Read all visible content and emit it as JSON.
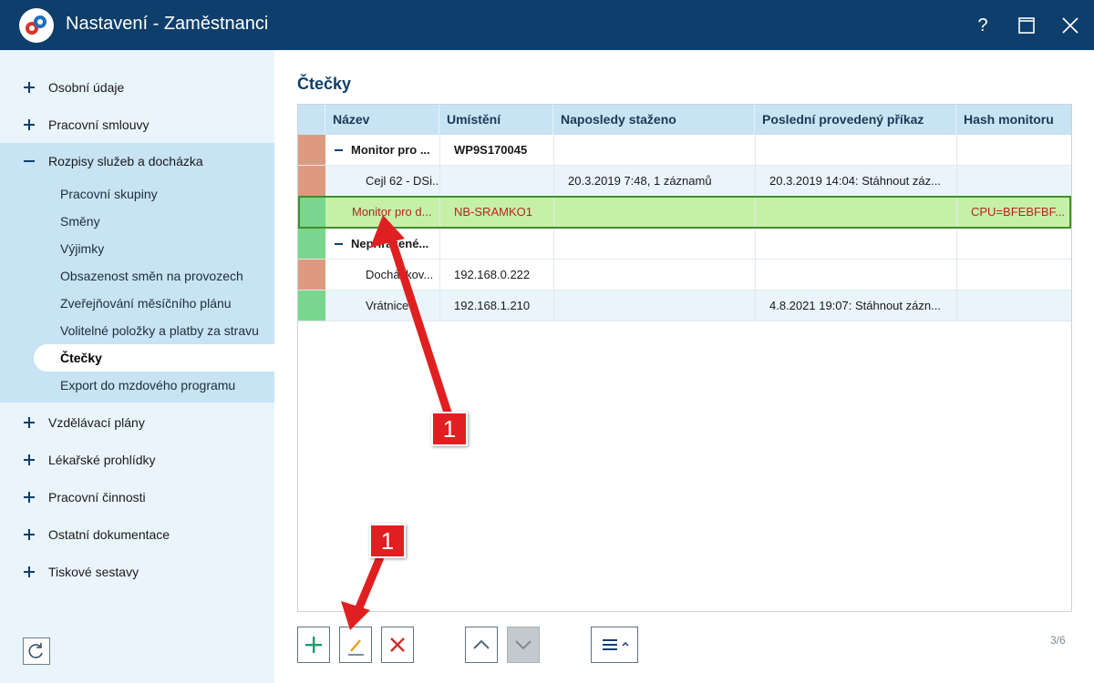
{
  "window": {
    "title": "Nastavení - Zaměstnanci",
    "help_label": "?"
  },
  "sidebar": {
    "top_items": [
      {
        "label": "Osobní údaje"
      },
      {
        "label": "Pracovní smlouvy"
      }
    ],
    "expanded_item": {
      "label": "Rozpisy služeb a docházka"
    },
    "sub_items": [
      {
        "label": "Pracovní skupiny"
      },
      {
        "label": "Směny"
      },
      {
        "label": "Výjimky"
      },
      {
        "label": "Obsazenost směn na provozech"
      },
      {
        "label": "Zveřejňování měsíčního plánu"
      },
      {
        "label": "Volitelné položky a platby za stravu"
      },
      {
        "label": "Čtečky"
      },
      {
        "label": "Export do mzdového programu"
      }
    ],
    "bottom_items": [
      {
        "label": "Vzdělávací plány"
      },
      {
        "label": "Lékařské prohlídky"
      },
      {
        "label": "Pracovní činnosti"
      },
      {
        "label": "Ostatní dokumentace"
      },
      {
        "label": "Tiskové sestavy"
      }
    ]
  },
  "main": {
    "title": "Čtečky",
    "columns": [
      "Název",
      "Umístění",
      "Naposledy staženo",
      "Poslední provedený příkaz",
      "Hash monitoru"
    ],
    "rows": [
      {
        "name": "Monitor pro ...",
        "location": "WP9S170045",
        "last_download": "",
        "last_command": "",
        "hash": ""
      },
      {
        "name": "Cejl 62 - DSi...",
        "location": "",
        "last_download": "20.3.2019 7:48, 1 záznamů",
        "last_command": "20.3.2019 14:04: Stáhnout záz...",
        "hash": ""
      },
      {
        "name": "Monitor pro d...",
        "location": "NB-SRAMKO1",
        "last_download": "",
        "last_command": "",
        "hash": "CPU=BFEBFBF..."
      },
      {
        "name": "Nepřiřazené...",
        "location": "",
        "last_download": "",
        "last_command": "",
        "hash": ""
      },
      {
        "name": "Docházkov...",
        "location": "192.168.0.222",
        "last_download": "",
        "last_command": "",
        "hash": ""
      },
      {
        "name": "Vrátnice",
        "location": "192.168.1.210",
        "last_download": "",
        "last_command": "4.8.2021 19:07: Stáhnout zázn...",
        "hash": ""
      }
    ],
    "page_count": "3/6"
  },
  "annotations": {
    "badge_top": "1",
    "badge_bottom": "1"
  },
  "colors": {
    "title_bar": "#0e3e6b",
    "status_red": "#de9a80",
    "status_green": "#78d68e",
    "selected_row": "#c6f0a8",
    "annotation_red": "#e02020"
  }
}
